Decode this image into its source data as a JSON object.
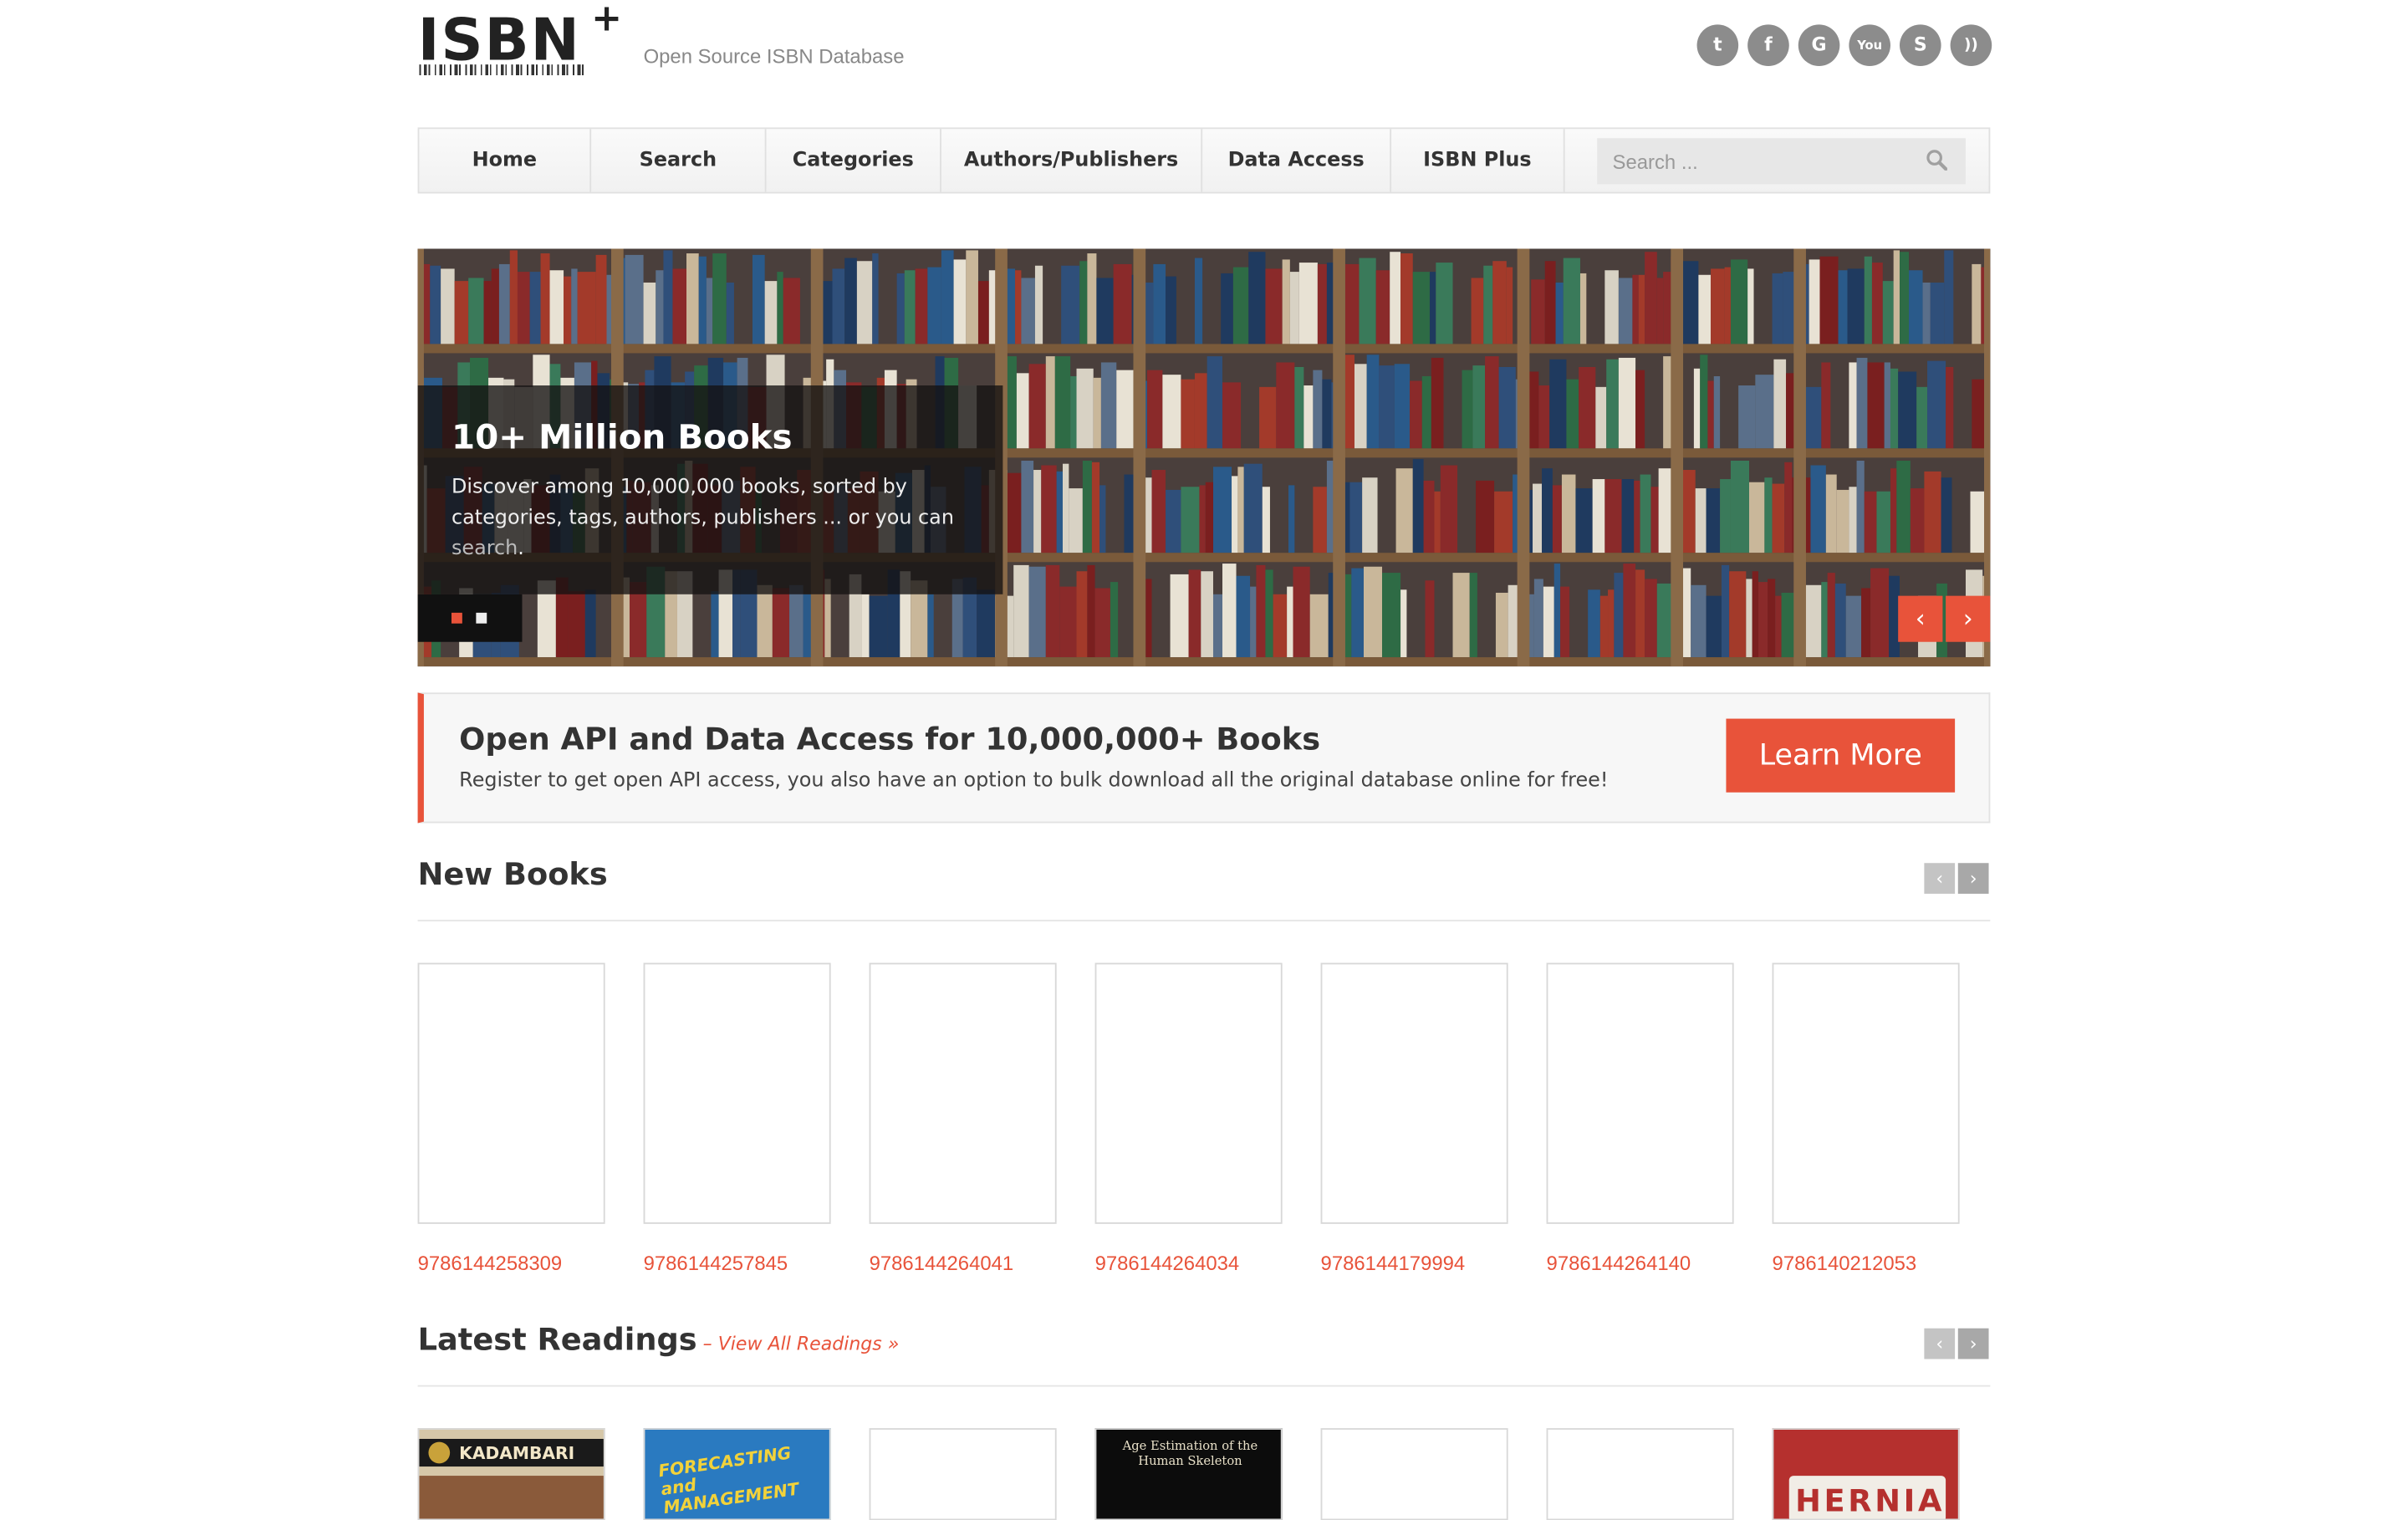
{
  "header": {
    "logo_text": "ISBN",
    "logo_plus": "+",
    "tagline": "Open Source ISBN Database",
    "social": [
      {
        "icon": "twitter-icon",
        "glyph": "t"
      },
      {
        "icon": "facebook-icon",
        "glyph": "f"
      },
      {
        "icon": "google-icon",
        "glyph": "G"
      },
      {
        "icon": "youtube-icon",
        "glyph": "You"
      },
      {
        "icon": "skype-icon",
        "glyph": "S"
      },
      {
        "icon": "rss-icon",
        "glyph": "))"
      }
    ]
  },
  "nav": {
    "items": [
      "Home",
      "Search",
      "Categories",
      "Authors/Publishers",
      "Data Access",
      "ISBN Plus"
    ],
    "search_placeholder": "Search ..."
  },
  "hero": {
    "title": "10+ Million Books",
    "text": "Discover among 10,000,000 books, sorted by categories, tags, authors, publishers ... or you can ",
    "link": "search",
    "end": ".",
    "prev": "‹",
    "next": "›"
  },
  "banner": {
    "title": "Open API and Data Access for 10,000,000+ Books",
    "text": "Register to get open API access, you also have an option to bulk download all the original database online for free!",
    "button": "Learn More"
  },
  "new_books": {
    "title": "New Books",
    "isbns": [
      "9786144258309",
      "9786144257845",
      "9786144264041",
      "9786144264034",
      "9786144179994",
      "9786144264140",
      "9786140212053"
    ]
  },
  "latest": {
    "title": "Latest Readings",
    "dash": " – ",
    "link": "View All Readings »",
    "covers": [
      "KADAMBARI",
      "FORECASTING and MANAGEMENT",
      "",
      "Age Estimation of the Human Skeleton",
      "",
      "",
      "HERNIA"
    ]
  },
  "pager": {
    "prev": "‹",
    "next": "›"
  },
  "colors": {
    "accent": "#e8533a",
    "social": "#8c8c8c"
  }
}
